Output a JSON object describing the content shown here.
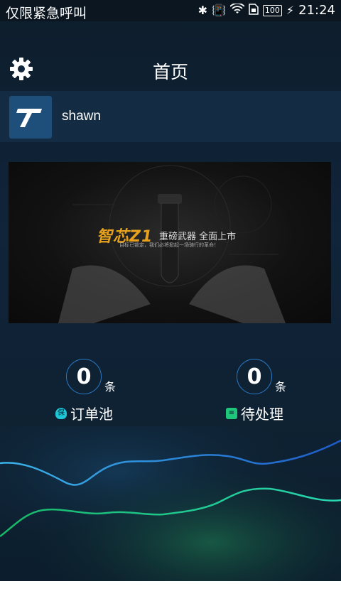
{
  "status_bar": {
    "left_text": "仅限紧急呼叫",
    "battery": "100",
    "time": "21:24"
  },
  "header": {
    "title": "首页"
  },
  "profile": {
    "username": "shawn"
  },
  "banner": {
    "title": "智芯Z1",
    "subtitle": "重磅武器 全面上市",
    "caption": "目标已锁定，我们必将掀起一场骑行的革命！"
  },
  "stats": [
    {
      "value": "0",
      "unit": "条",
      "label": "订单池",
      "icon": "shield-icon"
    },
    {
      "value": "0",
      "unit": "条",
      "label": "待处理",
      "icon": "clock-list-icon"
    }
  ],
  "colors": {
    "accent_blue": "#2b78c4",
    "wave_blue": "#1e90d6",
    "wave_green": "#1ec67a"
  }
}
